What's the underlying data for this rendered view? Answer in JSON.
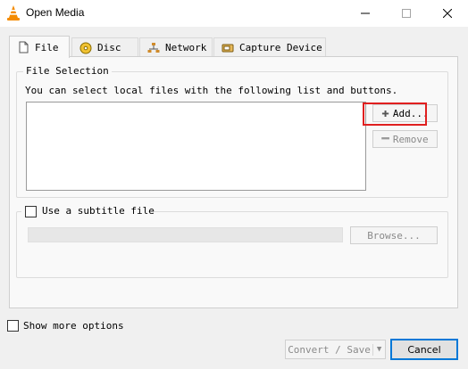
{
  "window": {
    "title": "Open Media",
    "controls": {
      "minimize": "—",
      "maximize": "☐",
      "close": "✕"
    }
  },
  "tabs": [
    {
      "label": "File",
      "icon": "file-icon",
      "active": true
    },
    {
      "label": "Disc",
      "icon": "disc-icon",
      "active": false
    },
    {
      "label": "Network",
      "icon": "network-icon",
      "active": false
    },
    {
      "label": "Capture Device",
      "icon": "capture-device-icon",
      "active": false
    }
  ],
  "file_selection": {
    "legend": "File Selection",
    "description": "You can select local files with the following list and buttons.",
    "add_label": "Add...",
    "remove_label": "Remove"
  },
  "subtitle": {
    "checkbox_label": "Use a subtitle file",
    "checked": false,
    "path_value": "",
    "browse_label": "Browse..."
  },
  "footer": {
    "show_more_label": "Show more options",
    "show_more_checked": false,
    "convert_label": "Convert / Save",
    "cancel_label": "Cancel"
  },
  "colors": {
    "highlight": "#e01f1f",
    "accent": "#0078d7",
    "vlc_orange": "#f48b00"
  }
}
